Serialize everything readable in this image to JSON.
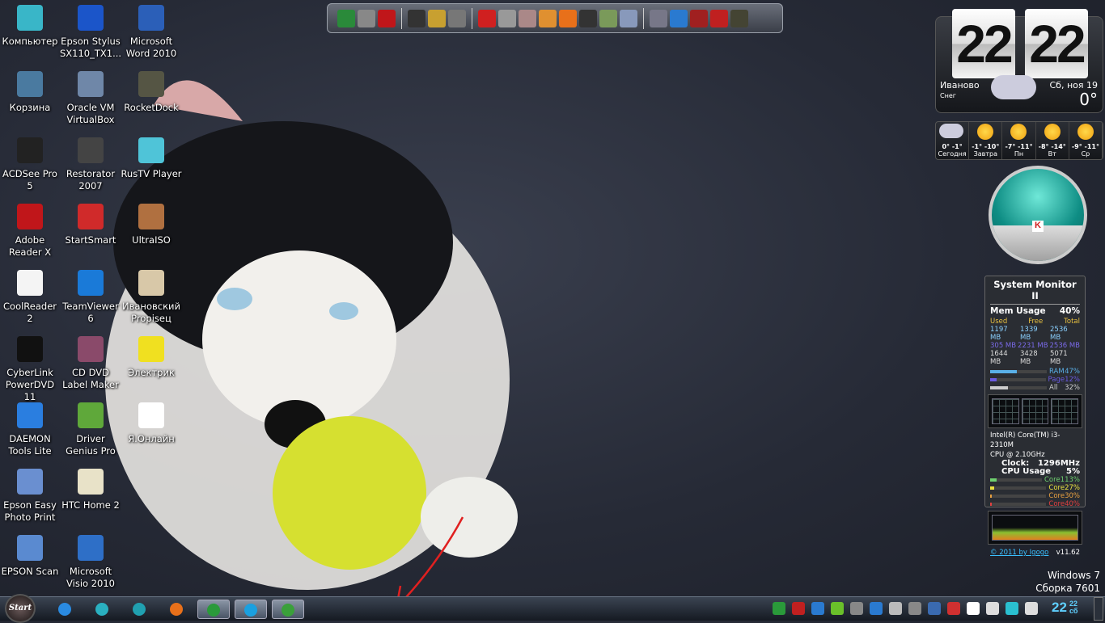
{
  "desktop_icons": [
    {
      "label": "Компьютер",
      "color": "#39b6c8"
    },
    {
      "label": "Корзина",
      "color": "#4a7aa0"
    },
    {
      "label": "ACDSee Pro 5",
      "color": "#222"
    },
    {
      "label": "Adobe Reader X",
      "color": "#c0161a"
    },
    {
      "label": "CoolReader 2",
      "color": "#f4f4f4"
    },
    {
      "label": "CyberLink PowerDVD 11",
      "color": "#111"
    },
    {
      "label": "DAEMON Tools Lite",
      "color": "#2a7ee0"
    },
    {
      "label": "Epson Easy Photo Print",
      "color": "#6a8fd0"
    },
    {
      "label": "EPSON Scan",
      "color": "#5a8ad0"
    },
    {
      "label": "Epson Stylus SX110_TX1...",
      "color": "#1b55c9"
    },
    {
      "label": "Oracle VM VirtualBox",
      "color": "#6f87a8"
    },
    {
      "label": "Restorator 2007",
      "color": "#444"
    },
    {
      "label": "StartSmart",
      "color": "#d02a2a"
    },
    {
      "label": "TeamViewer 6",
      "color": "#1a7ad8"
    },
    {
      "label": "CD DVD Label Maker",
      "color": "#8a4a6a"
    },
    {
      "label": "Driver Genius Pro",
      "color": "#5fa83a"
    },
    {
      "label": "HTC Home 2",
      "color": "#e8e2c8"
    },
    {
      "label": "Microsoft Visio 2010",
      "color": "#2e6fc7"
    },
    {
      "label": "Microsoft Word 2010",
      "color": "#2b5fb8"
    },
    {
      "label": "RocketDock",
      "color": "#554"
    },
    {
      "label": "RusTV Player",
      "color": "#4fc4d8"
    },
    {
      "label": "UltraISO",
      "color": "#b07040"
    },
    {
      "label": "Ивановский Propisец",
      "color": "#d8c8a8"
    },
    {
      "label": "Электрик",
      "color": "#f0e020"
    },
    {
      "label": "Я.Онлайн",
      "color": "#ffffff"
    }
  ],
  "dock_icons": [
    "#2a8a3a",
    "#888",
    "#c0161a",
    "sep",
    "#333",
    "#c8a030",
    "#777",
    "sep",
    "#d02020",
    "#999",
    "#a88",
    "#e09030",
    "#e8701a",
    "#333",
    "#7a9a5a",
    "#8899bb",
    "sep",
    "#778",
    "#2a7ad0",
    "#a02020",
    "#c02020",
    "#443"
  ],
  "clock": {
    "hours": "22",
    "minutes": "22"
  },
  "weather": {
    "city": "Иваново",
    "condition": "Снег",
    "date": "Сб, ноя 19",
    "temp": "0°",
    "forecast": [
      {
        "day": "Сегодня",
        "temps": "0° -1°",
        "icon": "snow-cloud"
      },
      {
        "day": "Завтра",
        "temps": "-1° -10°",
        "icon": "sun-cloud"
      },
      {
        "day": "Пн",
        "temps": "-7° -11°",
        "icon": "sun-cloud"
      },
      {
        "day": "Вт",
        "temps": "-8° -14°",
        "icon": "sun"
      },
      {
        "day": "Ср",
        "temps": "-9° -11°",
        "icon": "sun-cloud"
      }
    ]
  },
  "sysmon": {
    "title": "System Monitor II",
    "mem_label": "Mem Usage",
    "mem_pct": "40%",
    "cols": [
      "Used",
      "Free",
      "Total"
    ],
    "rows": [
      [
        "1197 MB",
        "1339 MB",
        "2536 MB"
      ],
      [
        "305 MB",
        "2231 MB",
        "2536 MB"
      ],
      [
        "1644 MB",
        "3428 MB",
        "5071 MB"
      ]
    ],
    "bars": [
      {
        "label": "RAM",
        "pct": "47%",
        "value": 47,
        "color": "#5ab0e8"
      },
      {
        "label": "Page",
        "pct": "12%",
        "value": 12,
        "color": "#6a5ae0"
      },
      {
        "label": "All",
        "pct": "32%",
        "value": 32,
        "color": "#ccc"
      }
    ],
    "cpu_name": "Intel(R) Core(TM) i3-2310M",
    "cpu_freq": "CPU @ 2.10GHz",
    "clock_label": "Clock:",
    "clock_value": "1296MHz",
    "cpu_label": "CPU Usage",
    "cpu_pct": "5%",
    "cores": [
      {
        "label": "Core1",
        "pct": "13%",
        "value": 13,
        "color": "#6fd06f"
      },
      {
        "label": "Core2",
        "pct": "7%",
        "value": 7,
        "color": "#e8e040"
      },
      {
        "label": "Core3",
        "pct": "0%",
        "value": 0,
        "color": "#e8a040"
      },
      {
        "label": "Core4",
        "pct": "0%",
        "value": 0,
        "color": "#e04040"
      }
    ],
    "footer_link": "© 2011 by Igogo",
    "version": "v11.62"
  },
  "taskbar": {
    "start_label": "Start",
    "pinned": [
      {
        "name": "internet-explorer",
        "color": "#2a8ae0"
      },
      {
        "name": "printer",
        "color": "#2ab0c0"
      },
      {
        "name": "media-player",
        "color": "#20a0b0"
      },
      {
        "name": "firefox",
        "color": "#e8701a"
      },
      {
        "name": "utorrent",
        "color": "#2a9a3a",
        "running": true
      },
      {
        "name": "skype",
        "color": "#1aa0e0",
        "running": true
      },
      {
        "name": "yandex-online",
        "color": "#3aa03a",
        "running": true
      }
    ],
    "tray": [
      "#2a9a3a",
      "#c02020",
      "#2a7ad0",
      "#6ac02a",
      "#888",
      "#2a7ad0",
      "#bbb",
      "#888",
      "#3a6ab0",
      "#d03030",
      "#fff",
      "#ddd",
      "#2ac0d0",
      "#ddd"
    ],
    "time": "22",
    "time_min": "22",
    "day": "сб"
  },
  "watermark": {
    "line1": "Windows 7",
    "line2": "Сборка 7601"
  }
}
